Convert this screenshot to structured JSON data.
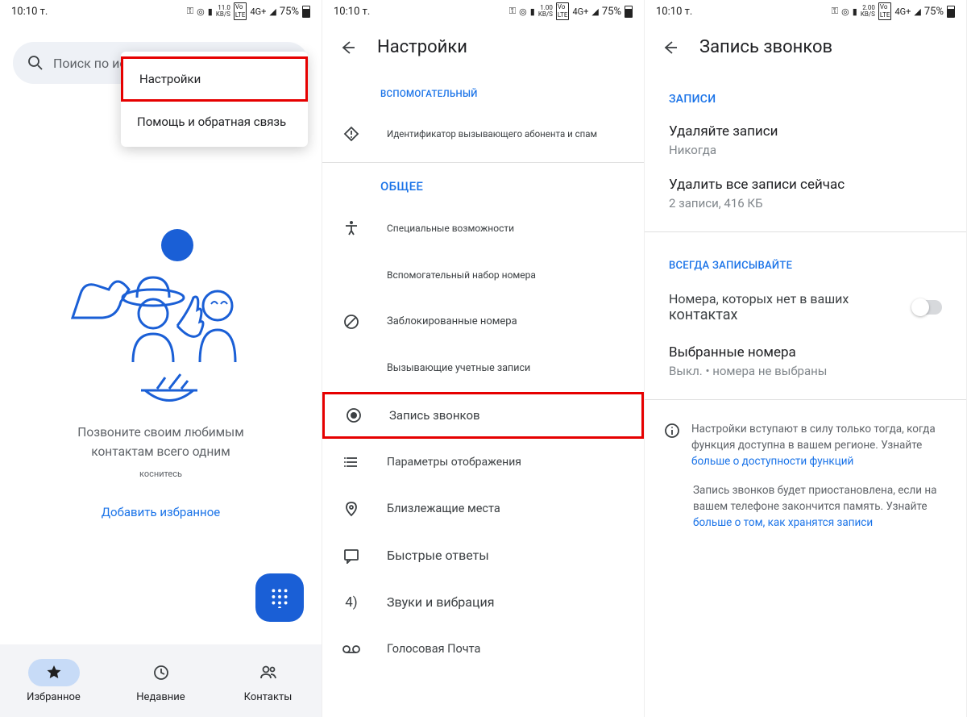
{
  "status": {
    "time": "10:10 т.",
    "battery": "75%",
    "netspeed1": "11.0",
    "netspeed2": "1.00",
    "netspeed3": "2.00",
    "netunit": "KB/S",
    "lte": "LTE",
    "vo": "Vo",
    "net4g": "4G+"
  },
  "s1": {
    "search_placeholder": "Поиск по истории звонков",
    "menu_settings": "Настройки",
    "menu_help": "Помощь и обратная связь",
    "promo_line1": "Позвоните своим любимым",
    "promo_line2": "контактам всего одним",
    "promo_line3": "коснитесь",
    "add_fav": "Добавить избранное",
    "nav_fav": "Избранное",
    "nav_recent": "Недавние",
    "nav_contacts": "Контакты"
  },
  "s2": {
    "title": "Настройки",
    "sec_aux": "ВСПОМОГАТЕЛЬНЫЙ",
    "caller_id": "Идентификатор вызывающего абонента и спам",
    "sec_general": "ОБЩЕЕ",
    "accessibility": "Специальные возможности",
    "assisted_dial": "Вспомогательный набор номера",
    "blocked": "Заблокированные номера",
    "calling_accounts": "Вызывающие учетные записи",
    "call_recording": "Запись звонков",
    "display_options": "Параметры отображения",
    "nearby": "Близлежащие места",
    "quick_responses": "Быстрые ответы",
    "sounds": "Звуки и вибрация",
    "voicemail": "Голосовая Почта"
  },
  "s3": {
    "title": "Запись звонков",
    "sec_recordings": "ЗАПИСИ",
    "delete_title": "Удаляйте записи",
    "delete_sub": "Никогда",
    "delete_all_title": "Удалить все записи сейчас",
    "delete_all_sub": "2 записи, 416 КБ",
    "sec_always": "ВСЕГДА ЗАПИСЫВАЙТЕ",
    "unknown_title1": "Номера, которых нет в ваших",
    "unknown_title2": "контактах",
    "selected_title": "Выбранные номера",
    "selected_sub": "Выкл. • номера не выбраны",
    "info1_a": "Настройки вступают в силу только тогда, когда функция доступна в вашем регионе. Узнайте ",
    "info1_link": "больше о доступности функций",
    "info2_a": "Запись звонков будет приостановлена, если на вашем телефоне закончится память. Узнайте ",
    "info2_link": "больше о том, как хранятся записи"
  }
}
